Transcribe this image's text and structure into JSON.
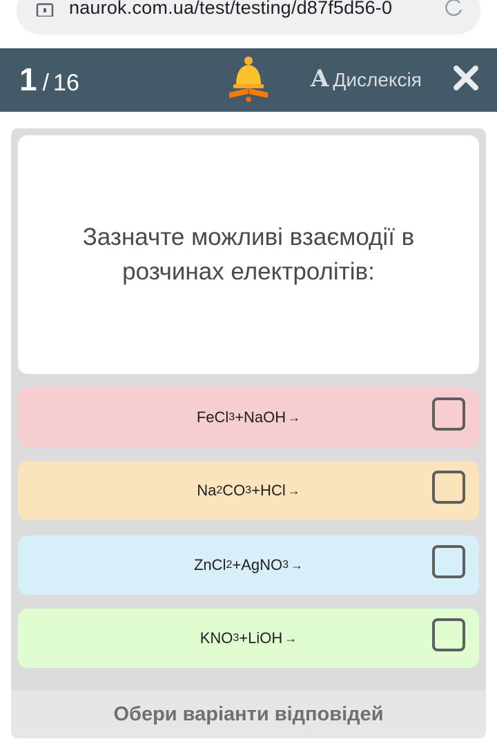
{
  "browser": {
    "url": "naurok.com.ua/test/testing/d87f5d56-0",
    "lock_icon": "lock-icon",
    "reload_icon": "reload-icon"
  },
  "header": {
    "current": "1",
    "separator": "/",
    "total": "16",
    "bell_icon": "bell-book-icon",
    "dyslexia_icon_letter": "A",
    "dyslexia_label": "Дислексія",
    "close_icon": "close-icon",
    "background": "#455a68"
  },
  "question": {
    "text": "Зазначте можливі взаємодії в розчинах електролітів:"
  },
  "options": [
    {
      "parts": [
        "FeCl",
        "3",
        "+NaOH"
      ],
      "color": "#f6cdd0",
      "checked": false
    },
    {
      "parts": [
        "Na",
        "2",
        "CO",
        "3",
        "+HCl"
      ],
      "color": "#fbe3bc",
      "checked": false
    },
    {
      "parts": [
        "ZnCl",
        "2",
        "+AgNO",
        "3"
      ],
      "color": "#d7eff9",
      "checked": false
    },
    {
      "parts": [
        "KNO",
        "3",
        "+LiOH"
      ],
      "color": "#e0fdd1",
      "checked": false
    }
  ],
  "arrow": "→",
  "footer": {
    "label": "Обери варіанти відповідей"
  }
}
